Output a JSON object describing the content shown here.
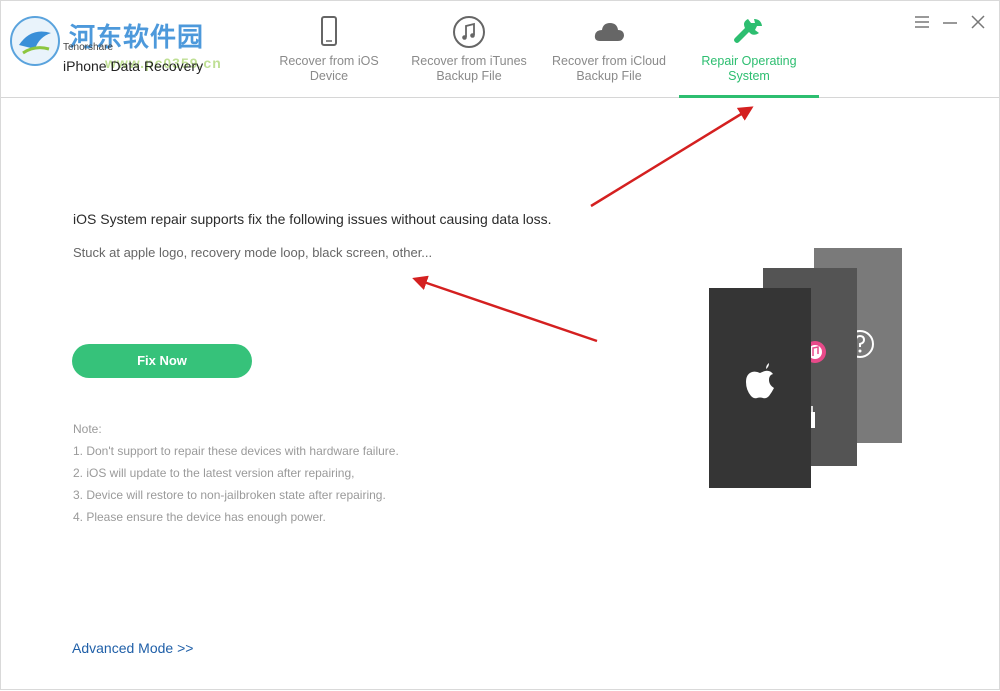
{
  "app": {
    "vendor": "Tenorshare",
    "product": "iPhone Data Recovery",
    "watermark": "河东软件园",
    "watermark_url": "www.pc0359.cn"
  },
  "tabs": [
    {
      "label": "Recover from iOS\nDevice",
      "icon": "phone-icon",
      "active": false
    },
    {
      "label": "Recover from iTunes\nBackup File",
      "icon": "music-note-icon",
      "active": false
    },
    {
      "label": "Recover from iCloud\nBackup File",
      "icon": "cloud-icon",
      "active": false
    },
    {
      "label": "Repair Operating\nSystem",
      "icon": "wrench-icon",
      "active": true
    }
  ],
  "main": {
    "headline": "iOS System repair supports fix the following issues without causing data loss.",
    "subline": "Stuck at apple logo, recovery mode loop, black screen, other...",
    "fix_button": "Fix Now",
    "notes_title": "Note:",
    "notes": [
      "1. Don't support to repair these devices with hardware failure.",
      "2. iOS will update to the latest version after repairing,",
      "3. Device will restore to non-jailbroken state after repairing.",
      "4. Please ensure the device has enough power."
    ],
    "advanced_link": "Advanced Mode >>"
  },
  "colors": {
    "accent": "#2dbe70",
    "button": "#36c27a",
    "link": "#1f5fa8",
    "annotation_arrow": "#d42020"
  }
}
